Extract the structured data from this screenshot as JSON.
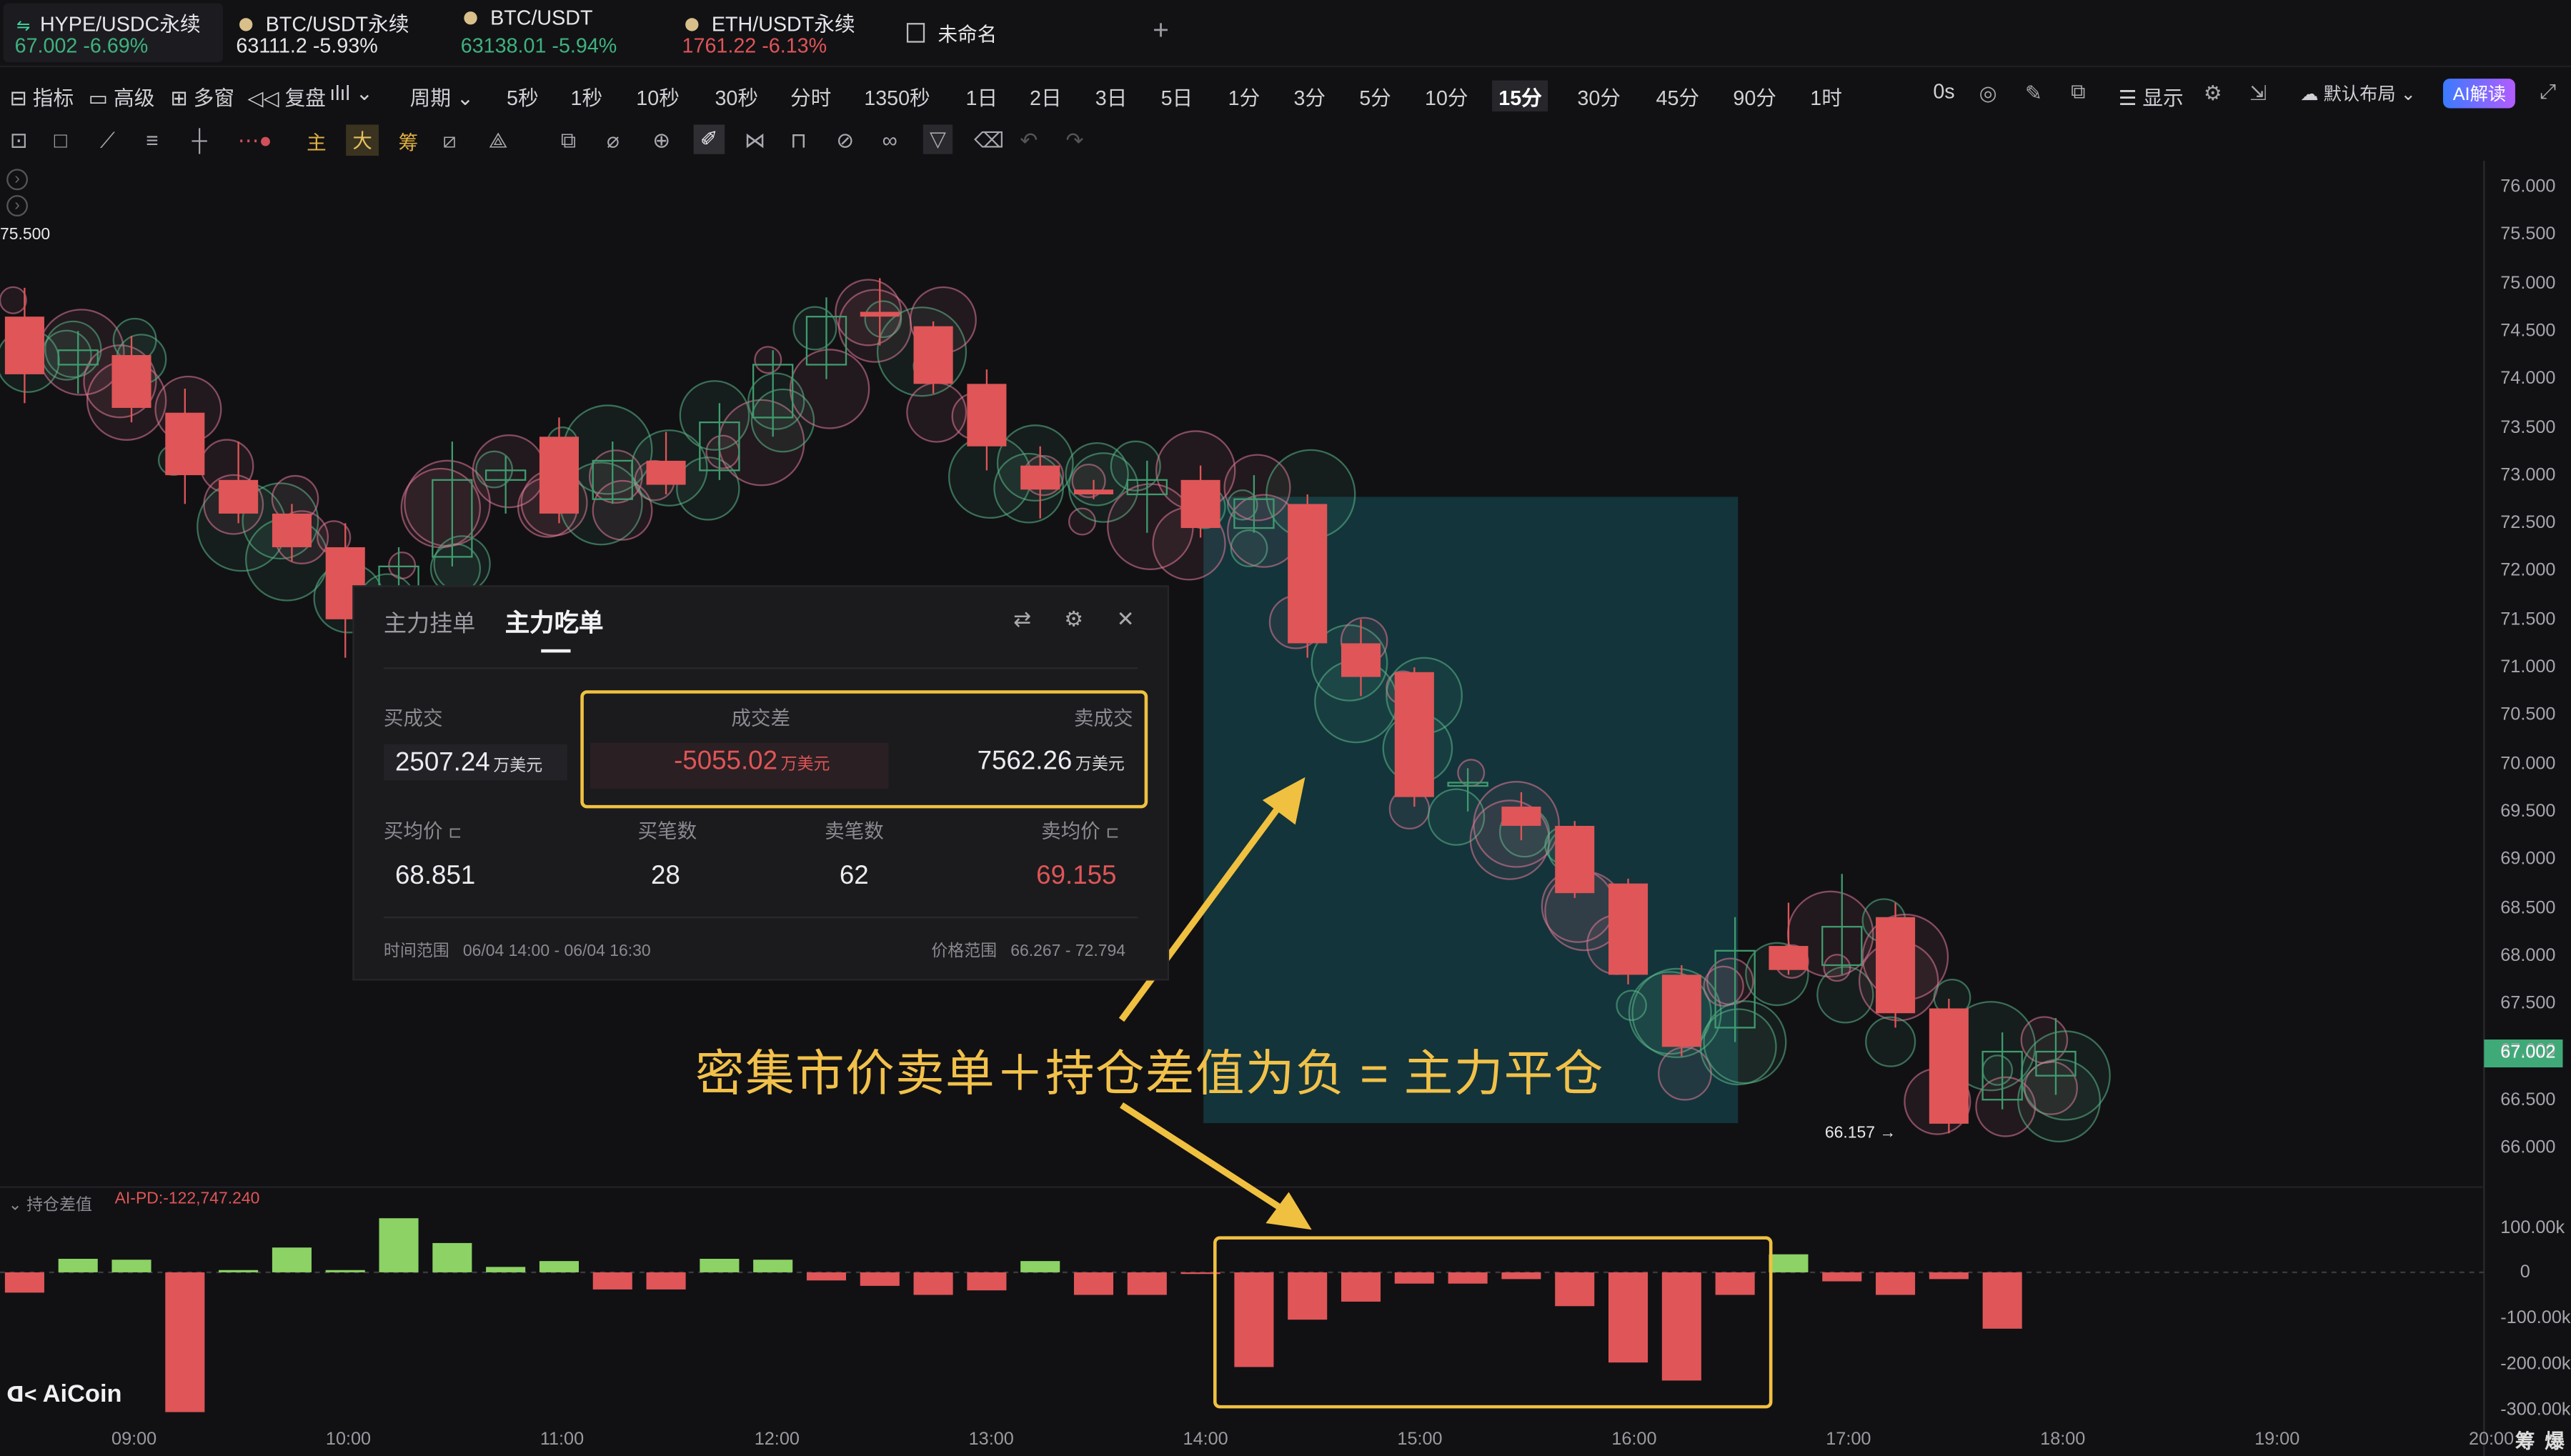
{
  "tabs": [
    {
      "name": "HYPE/USDC永续",
      "price": "67.002",
      "change": "-6.69%",
      "active": true
    },
    {
      "name": "BTC/USDT永续",
      "price": "63111.2",
      "change": "-5.93%"
    },
    {
      "name": "BTC/USDT",
      "price": "63138.01",
      "change": "-5.94%"
    },
    {
      "name": "ETH/USDT永续",
      "price": "1761.22",
      "change": "-6.13%"
    }
  ],
  "layout_tab": "未命名",
  "add_tab": "+",
  "toolbar": {
    "indicator": "指标",
    "advanced": "高级",
    "multi_window": "多窗",
    "replay": "复盘",
    "period": "周期",
    "display": "显示",
    "default_layout": "默认布局",
    "ai": "AI解读",
    "timer": "0s",
    "periods": [
      "5秒",
      "1秒",
      "10秒",
      "30秒",
      "分时",
      "1350秒",
      "1日",
      "2日",
      "3日",
      "5日",
      "1分",
      "3分",
      "5分",
      "10分",
      "15分",
      "30分",
      "45分",
      "90分",
      "1时"
    ],
    "active_period": "15分"
  },
  "draw_toolbar": {
    "main": "主",
    "big": "大",
    "chip": "筹"
  },
  "chart_data": {
    "type": "candlestick",
    "symbol": "HYPE/USDC永续",
    "interval": "15分",
    "y_ticks": [
      "76.000",
      "75.500",
      "75.000",
      "74.500",
      "74.000",
      "73.500",
      "73.000",
      "72.500",
      "72.000",
      "71.500",
      "71.000",
      "70.500",
      "70.000",
      "69.500",
      "69.000",
      "68.500",
      "68.000",
      "67.500",
      "67.000",
      "66.500",
      "66.000"
    ],
    "x_ticks": [
      "09:00",
      "10:00",
      "11:00",
      "12:00",
      "13:00",
      "14:00",
      "15:00",
      "16:00",
      "17:00",
      "18:00",
      "19:00",
      "20:00"
    ],
    "high_label": "75.500",
    "low_label": "66.157",
    "last_price": "67.002",
    "candles": [
      {
        "o": 74.65,
        "c": 74.05,
        "h": 74.95,
        "l": 73.75
      },
      {
        "o": 74.15,
        "c": 74.3,
        "h": 74.5,
        "l": 73.85
      },
      {
        "o": 74.25,
        "c": 73.7,
        "h": 74.45,
        "l": 73.55
      },
      {
        "o": 73.65,
        "c": 73.0,
        "h": 73.9,
        "l": 72.7
      },
      {
        "o": 72.95,
        "c": 72.6,
        "h": 73.35,
        "l": 72.5
      },
      {
        "o": 72.6,
        "c": 72.25,
        "h": 72.7,
        "l": 72.1
      },
      {
        "o": 72.25,
        "c": 71.5,
        "h": 72.5,
        "l": 71.1
      },
      {
        "o": 71.55,
        "c": 72.05,
        "h": 72.25,
        "l": 71.45
      },
      {
        "o": 72.15,
        "c": 72.95,
        "h": 73.35,
        "l": 72.05
      },
      {
        "o": 72.95,
        "c": 73.05,
        "h": 73.2,
        "l": 72.6
      },
      {
        "o": 73.4,
        "c": 72.6,
        "h": 73.6,
        "l": 72.5
      },
      {
        "o": 72.75,
        "c": 73.15,
        "h": 73.35,
        "l": 72.7
      },
      {
        "o": 73.15,
        "c": 72.9,
        "h": 73.45,
        "l": 72.8
      },
      {
        "o": 73.05,
        "c": 73.55,
        "h": 73.75,
        "l": 72.95
      },
      {
        "o": 73.6,
        "c": 74.15,
        "h": 74.3,
        "l": 73.4
      },
      {
        "o": 74.15,
        "c": 74.65,
        "h": 74.85,
        "l": 74.0
      },
      {
        "o": 74.7,
        "c": 74.65,
        "h": 75.05,
        "l": 74.35
      },
      {
        "o": 74.55,
        "c": 73.95,
        "h": 74.6,
        "l": 73.85
      },
      {
        "o": 73.95,
        "c": 73.3,
        "h": 74.1,
        "l": 73.05
      },
      {
        "o": 73.1,
        "c": 72.85,
        "h": 73.3,
        "l": 72.55
      },
      {
        "o": 72.85,
        "c": 72.8,
        "h": 72.95,
        "l": 72.75
      },
      {
        "o": 72.8,
        "c": 72.95,
        "h": 73.15,
        "l": 72.4
      },
      {
        "o": 72.95,
        "c": 72.45,
        "h": 73.1,
        "l": 72.35
      },
      {
        "o": 72.45,
        "c": 72.75,
        "h": 73.0,
        "l": 72.4
      },
      {
        "o": 72.7,
        "c": 71.25,
        "h": 72.8,
        "l": 71.1
      },
      {
        "o": 71.25,
        "c": 70.9,
        "h": 71.5,
        "l": 70.7
      },
      {
        "o": 70.95,
        "c": 69.65,
        "h": 71.0,
        "l": 69.55
      },
      {
        "o": 69.8,
        "c": 69.8,
        "h": 69.95,
        "l": 69.5
      },
      {
        "o": 69.55,
        "c": 69.35,
        "h": 69.7,
        "l": 69.2
      },
      {
        "o": 69.35,
        "c": 68.65,
        "h": 69.4,
        "l": 68.6
      },
      {
        "o": 68.75,
        "c": 67.8,
        "h": 68.8,
        "l": 67.7
      },
      {
        "o": 67.8,
        "c": 67.05,
        "h": 67.9,
        "l": 66.95
      },
      {
        "o": 67.25,
        "c": 68.05,
        "h": 68.4,
        "l": 67.1
      },
      {
        "o": 68.1,
        "c": 67.85,
        "h": 68.55,
        "l": 67.8
      },
      {
        "o": 67.9,
        "c": 68.3,
        "h": 68.85,
        "l": 67.8
      },
      {
        "o": 68.4,
        "c": 67.4,
        "h": 68.55,
        "l": 67.25
      },
      {
        "o": 67.45,
        "c": 66.25,
        "h": 67.55,
        "l": 66.15
      },
      {
        "o": 66.5,
        "c": 67.0,
        "h": 67.2,
        "l": 66.4
      },
      {
        "o": 66.75,
        "c": 67.0,
        "h": 67.35,
        "l": 66.55
      }
    ],
    "sub_indicator": {
      "name": "持仓差值",
      "label": "AI-PD:-122,747.240",
      "y_ticks": [
        "100.00k",
        "0",
        "-100.00k",
        "-200.00k",
        "-300.00k"
      ],
      "values": [
        -45000,
        30000,
        28000,
        -310000,
        5000,
        55000,
        5000,
        120000,
        65000,
        12000,
        25000,
        -38000,
        -38000,
        30000,
        28000,
        -18000,
        -30000,
        -50000,
        -40000,
        25000,
        -50000,
        -50000,
        -2000,
        -210000,
        -105000,
        -65000,
        -25000,
        -25000,
        -15000,
        -75000,
        -200000,
        -240000,
        -50000,
        40000,
        -20000,
        -50000,
        -15000,
        -125000
      ]
    }
  },
  "popup": {
    "tab1": "主力挂单",
    "tab2": "主力吃单",
    "buy_volume_label": "买成交",
    "buy_volume": "2507.24",
    "diff_label": "成交差",
    "diff": "-5055.02",
    "sell_volume_label": "卖成交",
    "sell_volume": "7562.26",
    "unit": "万美元",
    "buy_avg_label": "买均价",
    "buy_avg": "68.851",
    "buy_count_label": "买笔数",
    "buy_count": "28",
    "sell_count_label": "卖笔数",
    "sell_count": "62",
    "sell_avg_label": "卖均价",
    "sell_avg": "69.155",
    "time_range_label": "时间范围",
    "time_range": "06/04 14:00 - 06/04 16:30",
    "price_range_label": "价格范围",
    "price_range": "66.267 - 72.794"
  },
  "annotation": "密集市价卖单＋持仓差值为负 = 主力平仓",
  "watermark": "AiCoin",
  "chip_labels": [
    "筹",
    "爆"
  ],
  "colors": {
    "up": "#3f9b6e",
    "down": "#e05557",
    "accent": "#f0c040",
    "bar_up": "#8cd265",
    "highlight": "#13343a"
  }
}
